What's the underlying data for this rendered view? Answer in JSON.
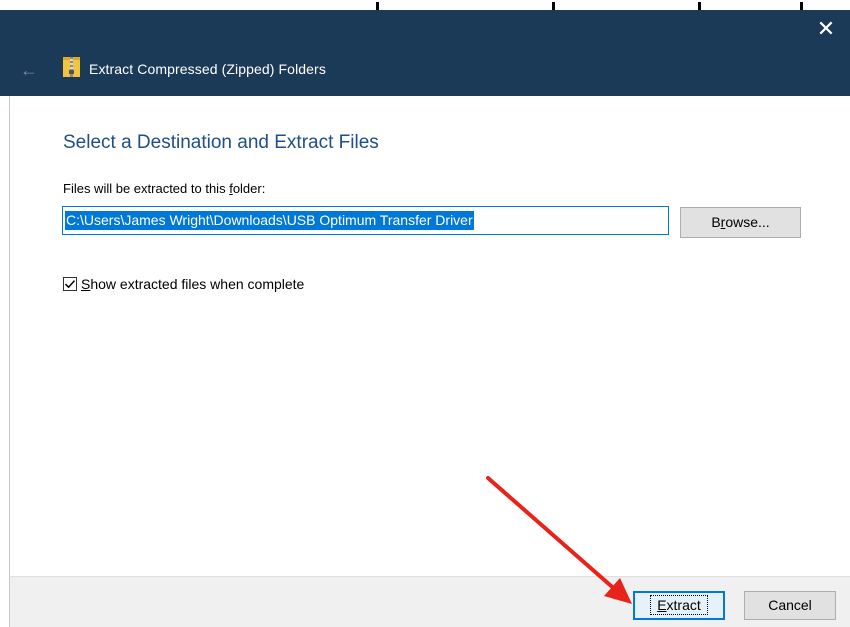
{
  "window": {
    "title": "Extract Compressed (Zipped) Folders",
    "close_glyph": "✕",
    "back_glyph": "←"
  },
  "content": {
    "heading": "Select a Destination and Extract Files",
    "folder_label_pre": "Files will be extracted to this ",
    "folder_label_accel": "f",
    "folder_label_post": "older:",
    "path_value": "C:\\Users\\James Wright\\Downloads\\USB Optimum Transfer Driver",
    "browse_pre": "B",
    "browse_accel": "r",
    "browse_post": "owse...",
    "checkbox_checked": true,
    "checkbox_accel": "S",
    "checkbox_label_post": "how extracted files when complete"
  },
  "footer": {
    "extract_accel": "E",
    "extract_post": "xtract",
    "cancel_label": "Cancel"
  },
  "icons": {
    "zip": "zip-folder-icon",
    "check": "checkmark-icon",
    "arrow": "red-arrow-annotation"
  },
  "colors": {
    "titlebar": "#1b3a57",
    "accent": "#0078d7",
    "heading": "#1f4e8a",
    "annotation": "#e8231b"
  }
}
